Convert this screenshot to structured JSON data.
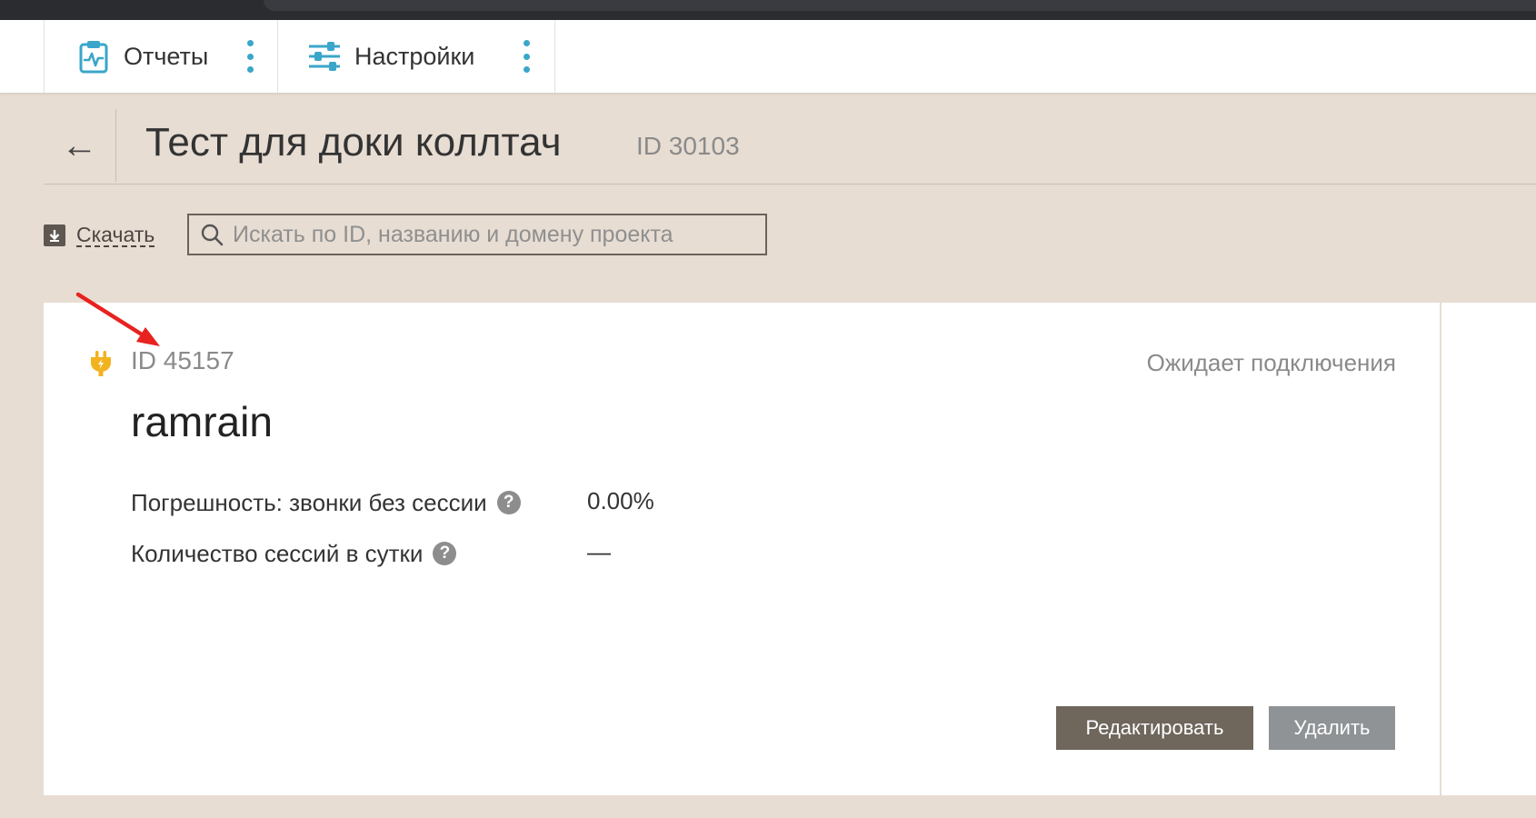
{
  "navbar": {
    "items": [
      {
        "label": "Отчеты",
        "icon": "clipboard-pulse-icon"
      },
      {
        "label": "Настройки",
        "icon": "sliders-icon"
      }
    ],
    "accent_color": "#3aa6c9"
  },
  "header": {
    "back_symbol": "←",
    "title": "Тест для доки коллтач",
    "id_label": "ID 30103"
  },
  "toolbar": {
    "download_label": "Скачать",
    "search_placeholder": "Искать по ID, названию и домену проекта"
  },
  "project_card": {
    "id_label": "ID 45157",
    "status": "Ожидает подключения",
    "status_icon_color": "#f2b320",
    "name": "ramrain",
    "stats": [
      {
        "label": "Погрешность: звонки без сессии",
        "value": "0.00%"
      },
      {
        "label": "Количество сессий в сутки",
        "value": "—"
      }
    ],
    "help_symbol": "?",
    "edit_label": "Редактировать",
    "delete_label": "Удалить"
  }
}
